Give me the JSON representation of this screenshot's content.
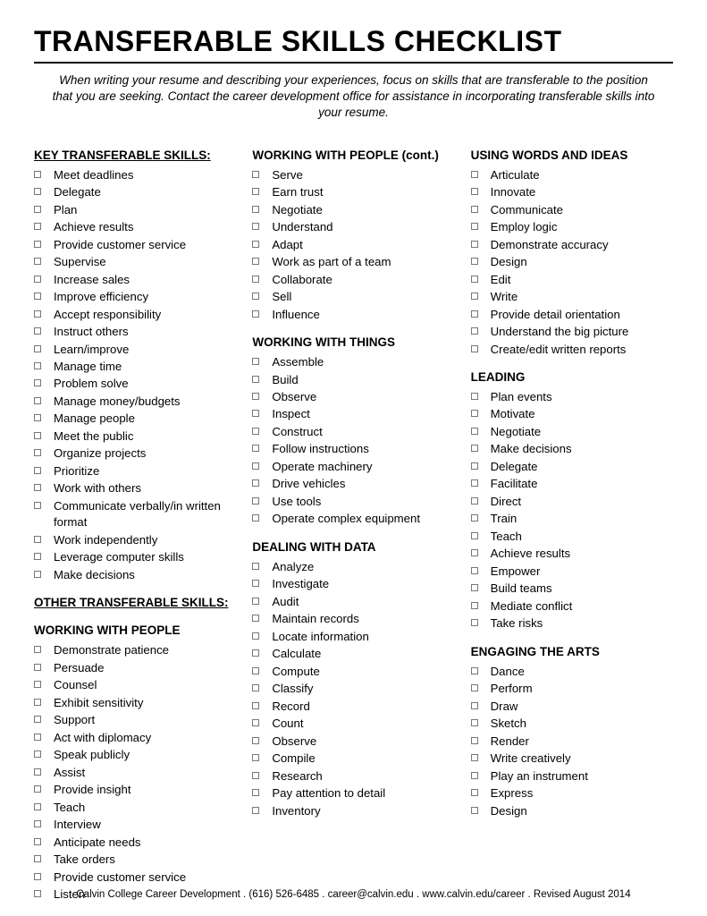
{
  "title": "TRANSFERABLE SKILLS CHECKLIST",
  "intro": "When writing your resume and describing your experiences, focus on skills that are transferable to the position that you are seeking.  Contact the career development office for assistance in incorporating transferable skills into your resume.",
  "columns": [
    [
      {
        "heading": "KEY TRANSFERABLE SKILLS:",
        "underline": true,
        "spaceBefore": false,
        "items": [
          "Meet deadlines",
          "Delegate",
          "Plan",
          "Achieve results",
          "Provide customer service",
          "Supervise",
          "Increase sales",
          "Improve efficiency",
          "Accept responsibility",
          "Instruct others",
          "Learn/improve",
          "Manage time",
          "Problem solve",
          "Manage money/budgets",
          "Manage people",
          "Meet the public",
          "Organize projects",
          "Prioritize",
          "Work with others",
          "Communicate verbally/in written format",
          "Work independently",
          "Leverage computer skills",
          "Make decisions"
        ]
      },
      {
        "heading": "OTHER TRANSFERABLE SKILLS:",
        "underline": true,
        "items": []
      },
      {
        "heading": "WORKING WITH PEOPLE",
        "underline": false,
        "items": [
          "Demonstrate patience",
          "Persuade",
          "Counsel",
          "Exhibit sensitivity",
          "Support",
          "Act with diplomacy",
          "Speak publicly",
          "Assist",
          "Provide insight",
          "Teach",
          "Interview",
          "Anticipate needs",
          "Take orders",
          "Provide customer service",
          "Listen"
        ]
      }
    ],
    [
      {
        "heading": "WORKING WITH PEOPLE (cont.)",
        "underline": false,
        "items": [
          "Serve",
          "Earn trust",
          "Negotiate",
          "Understand",
          "Adapt",
          "Work as part of a team",
          "Collaborate",
          "Sell",
          "Influence"
        ]
      },
      {
        "heading": "WORKING WITH THINGS",
        "underline": false,
        "items": [
          "Assemble",
          "Build",
          "Observe",
          "Inspect",
          "Construct",
          "Follow instructions",
          "Operate machinery",
          "Drive vehicles",
          "Use tools",
          "Operate complex equipment"
        ]
      },
      {
        "heading": "DEALING WITH DATA",
        "underline": false,
        "items": [
          "Analyze",
          "Investigate",
          "Audit",
          "Maintain records",
          "Locate information",
          "Calculate",
          "Compute",
          "Classify",
          "Record",
          "Count",
          "Observe",
          "Compile",
          "Research",
          "Pay attention to detail",
          "Inventory"
        ]
      }
    ],
    [
      {
        "heading": "USING WORDS AND IDEAS",
        "underline": false,
        "items": [
          "Articulate",
          "Innovate",
          "Communicate",
          "Employ logic",
          "Demonstrate accuracy",
          "Design",
          "Edit",
          "Write",
          "Provide detail orientation",
          "Understand the big picture",
          "Create/edit written reports"
        ]
      },
      {
        "heading": "LEADING",
        "underline": false,
        "items": [
          "Plan events",
          "Motivate",
          "Negotiate",
          "Make decisions",
          "Delegate",
          "Facilitate",
          "Direct",
          "Train",
          "Teach",
          "Achieve results",
          "Empower",
          "Build teams",
          "Mediate conflict",
          "Take risks"
        ]
      },
      {
        "heading": "ENGAGING THE ARTS",
        "underline": false,
        "items": [
          "Dance",
          "Perform",
          "Draw",
          "Sketch",
          "Render",
          "Write creatively",
          "Play an instrument",
          "Express",
          "Design"
        ]
      }
    ]
  ],
  "footer": "Calvin College Career Development  .  (616) 526-6485  .  career@calvin.edu  .  www.calvin.edu/career  .  Revised August 2014"
}
